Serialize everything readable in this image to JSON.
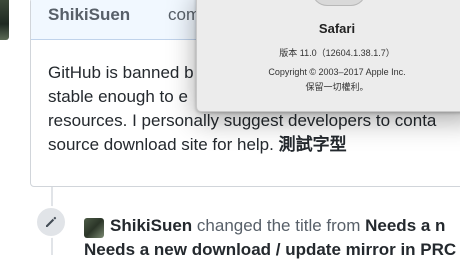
{
  "comment": {
    "author": "ShikiSuen",
    "verb": "comme",
    "body_lines": [
      "GitHub is banned b",
      "stable enough to e",
      "resources. I personally suggest developers to conta",
      "source download site for help. "
    ],
    "body_bold_suffix": "測試字型"
  },
  "timeline_event": {
    "actor": "ShikiSuen",
    "action_text": " changed the title from ",
    "title_from_fragment": "Needs a n",
    "second_line_fragment": "Needs a new download / update mirror in PRC"
  },
  "about_dialog": {
    "app_name": "Safari",
    "version": "版本 11.0（12604.1.38.1.7）",
    "copyright": "Copyright © 2003–2017 Apple Inc.",
    "rights": "保留一切權利。"
  },
  "colors": {
    "header_bg": "#f1f8ff",
    "border": "#d1d5da",
    "text": "#24292e",
    "muted": "#586069",
    "dialog_bg": "#ececec"
  },
  "icons": {
    "timeline_badge": "pencil-icon"
  }
}
